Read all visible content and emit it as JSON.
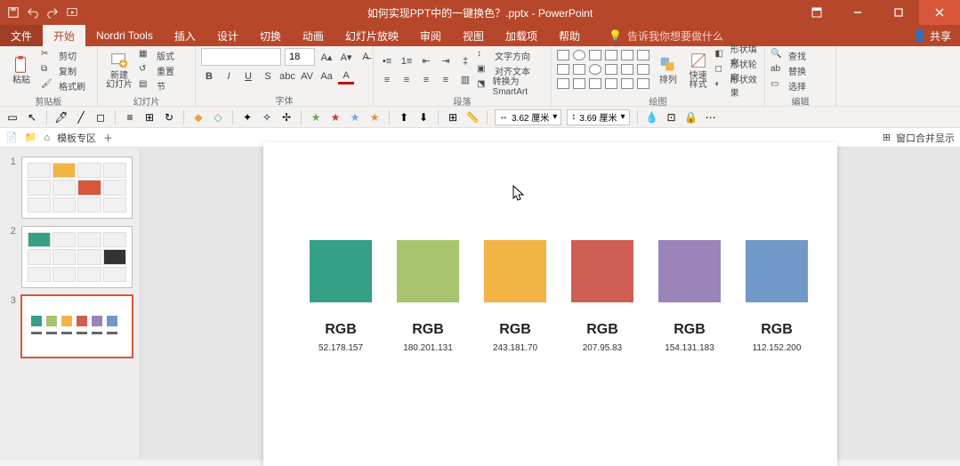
{
  "title": "如何实现PPT中的一键换色？.pptx - PowerPoint",
  "tabs": {
    "file": "文件",
    "home": "开始",
    "nordri": "Nordri Tools",
    "insert": "插入",
    "design": "设计",
    "transitions": "切换",
    "animations": "动画",
    "slideshow": "幻灯片放映",
    "review": "审阅",
    "view": "视图",
    "addins": "加载项",
    "help": "帮助"
  },
  "tellme": "告诉我你想要做什么",
  "share": "共享",
  "ribbon": {
    "clipboard": {
      "paste": "粘贴",
      "cut": "剪切",
      "copy": "复制",
      "formatpaint": "格式刷",
      "label": "剪贴板"
    },
    "slides": {
      "newslide": "新建\n幻灯片",
      "layout": "版式",
      "reset": "重置",
      "section": "节",
      "label": "幻灯片"
    },
    "font": {
      "size": "18",
      "label": "字体"
    },
    "paragraph": {
      "dir": "文字方向",
      "align": "对齐文本",
      "smartart": "转换为 SmartArt",
      "label": "段落"
    },
    "drawing": {
      "arrange": "排列",
      "quickstyles": "快速样式",
      "fill": "形状填充",
      "outline": "形状轮廓",
      "effects": "形状效果",
      "label": "绘图"
    },
    "editing": {
      "find": "查找",
      "replace": "替换",
      "select": "选择",
      "label": "编辑"
    }
  },
  "toolbar2": {
    "w": "3.62 厘米",
    "h": "3.69 厘米"
  },
  "breadcrumb": {
    "templates": "模板专区",
    "merge": "窗口合并显示"
  },
  "thumbs": [
    "1",
    "2",
    "3"
  ],
  "slide": {
    "items": [
      {
        "title": "RGB",
        "val": "52.178.157",
        "cls": "c-teal"
      },
      {
        "title": "RGB",
        "val": "180.201.131",
        "cls": "c-olive"
      },
      {
        "title": "RGB",
        "val": "243.181.70",
        "cls": "c-amber"
      },
      {
        "title": "RGB",
        "val": "207.95.83",
        "cls": "c-red"
      },
      {
        "title": "RGB",
        "val": "154.131.183",
        "cls": "c-purple"
      },
      {
        "title": "RGB",
        "val": "112.152.200",
        "cls": "c-blue"
      }
    ]
  }
}
